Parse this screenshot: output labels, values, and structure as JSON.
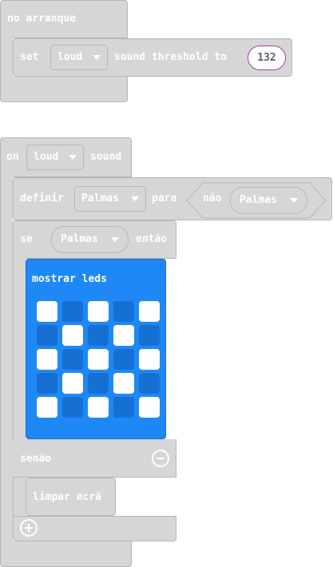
{
  "on_start": {
    "header": "no arranque",
    "set_label": "set",
    "dropdown_value": "loud",
    "suffix": "sound threshold to",
    "threshold_value": "132"
  },
  "on_sound": {
    "prefix": "on",
    "dropdown_value": "loud",
    "suffix": "sound",
    "define_label": "definir",
    "define_var": "Palmas",
    "para_label": "para",
    "not_label": "não",
    "not_var": "Palmas",
    "if_label": "se",
    "if_var": "Palmas",
    "then_label": "então",
    "show_leds_label": "mostrar leds",
    "leds": [
      [
        1,
        0,
        1,
        0,
        1
      ],
      [
        0,
        1,
        0,
        1,
        0
      ],
      [
        1,
        0,
        1,
        0,
        1
      ],
      [
        0,
        1,
        0,
        1,
        0
      ],
      [
        1,
        0,
        1,
        0,
        1
      ]
    ],
    "else_label": "senão",
    "clear_label": "limpar ecrã"
  },
  "colors": {
    "block_gray": "#d6d6d6",
    "block_border": "#b6b6b6",
    "led_block_blue": "#1e88f6",
    "led_on": "#ffffff",
    "led_off": "#1670d3",
    "number_outline": "#a040a0"
  },
  "icons": {
    "else_remove": "minus-circle-icon",
    "add_branch": "plus-circle-icon"
  }
}
